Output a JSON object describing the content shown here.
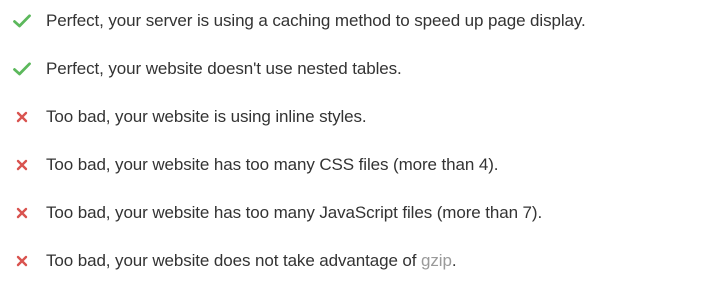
{
  "colors": {
    "success": "#5cb85c",
    "error": "#d9534f",
    "text": "#333333",
    "link": "#9a9a9a"
  },
  "results": [
    {
      "status": "pass",
      "icon": "check-icon",
      "text": "Perfect, your server is using a caching method to speed up page display."
    },
    {
      "status": "pass",
      "icon": "check-icon",
      "text": "Perfect, your website doesn't use nested tables."
    },
    {
      "status": "fail",
      "icon": "cross-icon",
      "text": "Too bad, your website is using inline styles."
    },
    {
      "status": "fail",
      "icon": "cross-icon",
      "text": "Too bad, your website has too many CSS files (more than 4)."
    },
    {
      "status": "fail",
      "icon": "cross-icon",
      "text": "Too bad, your website has too many JavaScript files (more than 7)."
    },
    {
      "status": "fail",
      "icon": "cross-icon",
      "text_prefix": "Too bad, your website does not take advantage of ",
      "link_text": "gzip",
      "text_suffix": "."
    }
  ]
}
